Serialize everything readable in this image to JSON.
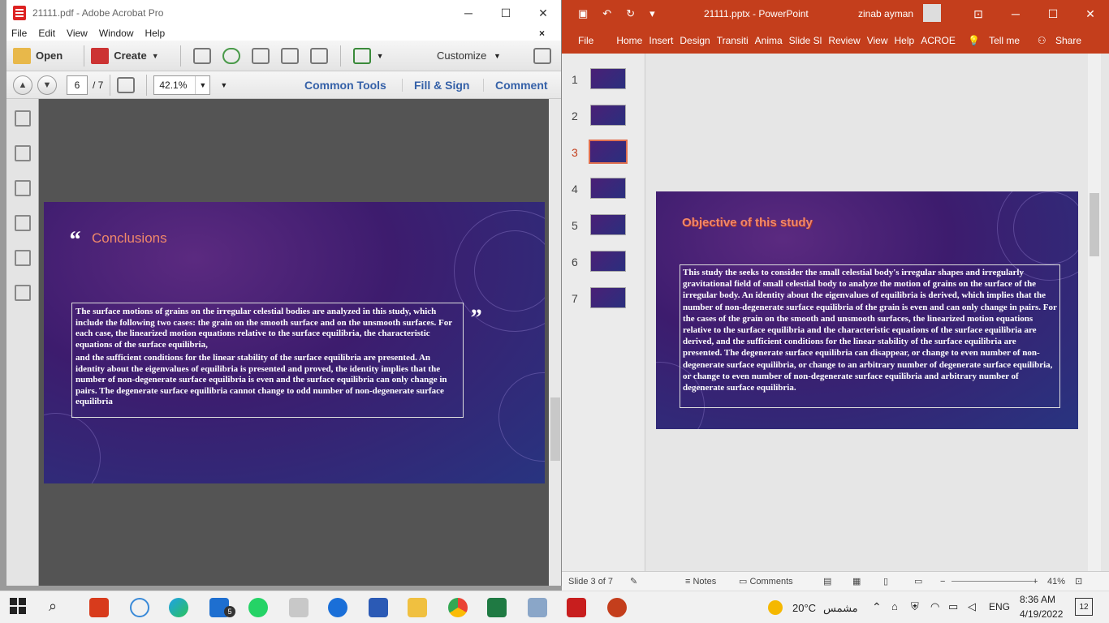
{
  "acrobat": {
    "title": "21111.pdf - Adobe Acrobat Pro",
    "menu": [
      "File",
      "Edit",
      "View",
      "Window",
      "Help"
    ],
    "close_doc": "×",
    "toolbar": {
      "open": "Open",
      "create": "Create",
      "customize": "Customize"
    },
    "nav": {
      "page": "6",
      "total": "/ 7",
      "zoom": "42.1%"
    },
    "links": [
      "Common Tools",
      "Fill & Sign",
      "Comment"
    ],
    "slide": {
      "title": "Conclusions",
      "open_quote": "“",
      "close_quote": "”",
      "para1": "The surface motions of grains on the irregular celestial bodies are analyzed in this study, which include the following two cases: the grain on the smooth surface and on the unsmooth surfaces. For each case, the linearized motion equations relative to the surface equilibria, the characteristic equations of the surface equilibria,",
      "para2": "and the sufficient conditions for the linear stability of the surface equilibria are presented. An identity about the eigenvalues of equilibria is presented and proved, the identity implies that the number of non-degenerate surface equilibria is even and the surface equilibria can only change in pairs. The degenerate surface equilibria cannot change to odd number of non-degenerate surface equilibria"
    }
  },
  "powerpoint": {
    "filename": "21111.pptx - PowerPoint",
    "user": "zinab ayman",
    "tabs": [
      "File",
      "Home",
      "Insert",
      "Design",
      "Transiti",
      "Anima",
      "Slide Sl",
      "Review",
      "View",
      "Help",
      "ACROE"
    ],
    "tell_me": "Tell me",
    "share": "Share",
    "thumbs": [
      "1",
      "2",
      "3",
      "4",
      "5",
      "6",
      "7"
    ],
    "slide": {
      "title": "Objective of this study",
      "body": "This study the seeks to consider the small celestial body's irregular shapes and irregularly gravitational field of small celestial body to analyze the motion of grains on the surface of the irregular body. An identity about the eigenvalues of equilibria is derived, which implies that the number of non-degenerate surface equilibria of the grain is even and can only change in pairs. For the cases of the grain on the smooth and unsmooth surfaces, the linearized motion equations relative to the surface equilibria and the characteristic equations of the surface equilibria are derived, and the sufficient conditions for the linear stability of the surface equilibria are presented. The degenerate surface equilibria can disappear, or change to even number of non-degenerate surface equilibria, or change to an arbitrary number of degenerate surface equilibria, or change to even number of non-degenerate surface equilibria and arbitrary number of degenerate surface equilibria."
    },
    "status": {
      "slide": "Slide 3 of 7",
      "notes": "Notes",
      "comments": "Comments",
      "zoom": "41%"
    }
  },
  "taskbar": {
    "weather": "20°C",
    "weather_text": "مشمس",
    "lang": "ENG",
    "time": "8:36 AM",
    "date": "4/19/2022",
    "notif": "12",
    "badge": "5"
  },
  "colors": {
    "ppt_red": "#c43e1c",
    "link_blue": "#3561a8",
    "slide_title": "#f0886a"
  }
}
